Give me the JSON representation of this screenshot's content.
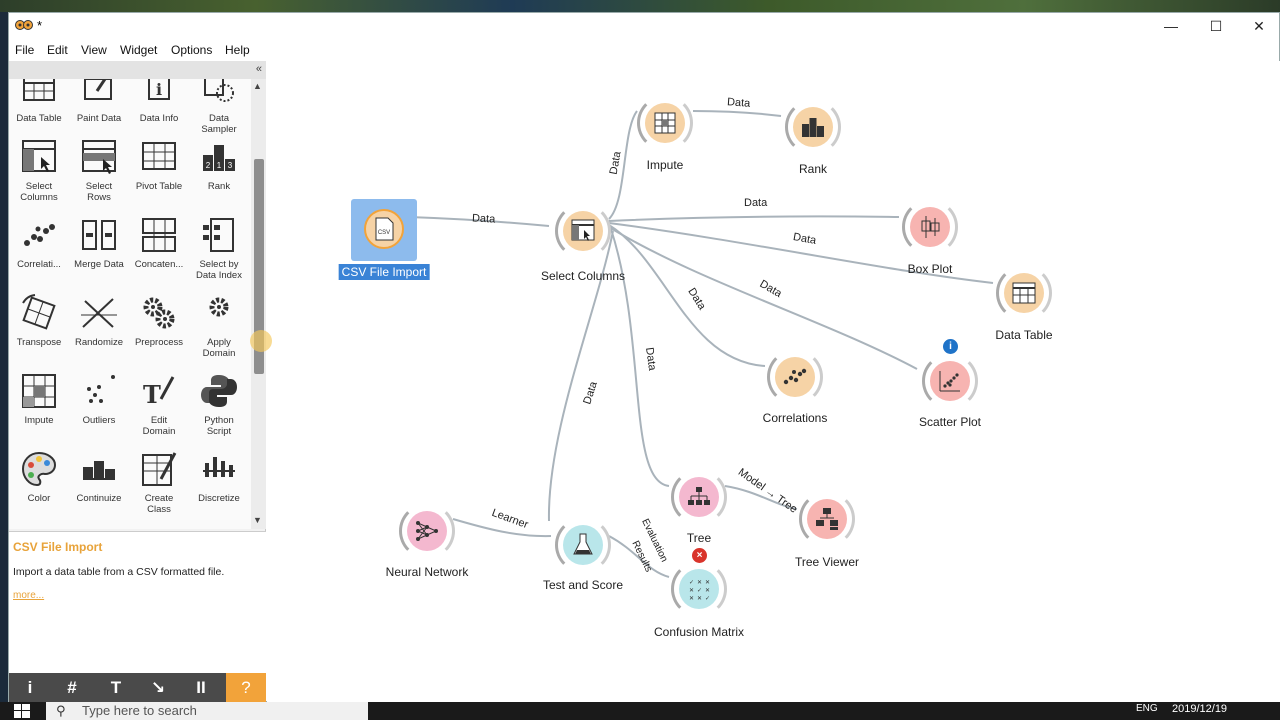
{
  "window": {
    "title": "*"
  },
  "menu": [
    "File",
    "Edit",
    "View",
    "Widget",
    "Options",
    "Help"
  ],
  "widgets": [
    {
      "label": "Data Table",
      "icon": "data-table-icon"
    },
    {
      "label": "Paint Data",
      "icon": "paint-data-icon"
    },
    {
      "label": "Data Info",
      "icon": "data-info-icon"
    },
    {
      "label": "Data\nSampler",
      "icon": "data-sampler-icon"
    },
    {
      "label": "Select\nColumns",
      "icon": "select-columns-icon"
    },
    {
      "label": "Select\nRows",
      "icon": "select-rows-icon"
    },
    {
      "label": "Pivot Table",
      "icon": "pivot-table-icon"
    },
    {
      "label": "Rank",
      "icon": "rank-icon"
    },
    {
      "label": "Correlati...",
      "icon": "correlations-icon"
    },
    {
      "label": "Merge Data",
      "icon": "merge-data-icon"
    },
    {
      "label": "Concaten...",
      "icon": "concatenate-icon"
    },
    {
      "label": "Select by\nData Index",
      "icon": "select-by-index-icon"
    },
    {
      "label": "Transpose",
      "icon": "transpose-icon"
    },
    {
      "label": "Randomize",
      "icon": "randomize-icon"
    },
    {
      "label": "Preprocess",
      "icon": "preprocess-icon"
    },
    {
      "label": "Apply\nDomain",
      "icon": "apply-domain-icon"
    },
    {
      "label": "Impute",
      "icon": "impute-icon"
    },
    {
      "label": "Outliers",
      "icon": "outliers-icon"
    },
    {
      "label": "Edit\nDomain",
      "icon": "edit-domain-icon"
    },
    {
      "label": "Python\nScript",
      "icon": "python-script-icon"
    },
    {
      "label": "Color",
      "icon": "color-icon"
    },
    {
      "label": "Continuize",
      "icon": "continuize-icon"
    },
    {
      "label": "Create\nClass",
      "icon": "create-class-icon"
    },
    {
      "label": "Discretize",
      "icon": "discretize-icon"
    }
  ],
  "help": {
    "title": "CSV File Import",
    "description": "Import a data table from a CSV formatted file.",
    "more": "more..."
  },
  "toolbar": {
    "info": "i",
    "grid": "#",
    "text": "T",
    "arrow": "↘",
    "pause": "II",
    "help": "?"
  },
  "nodes": {
    "csv": "CSV File Import",
    "select_columns": "Select Columns",
    "impute": "Impute",
    "rank": "Rank",
    "box_plot": "Box Plot",
    "data_table": "Data Table",
    "correlations": "Correlations",
    "scatter_plot": "Scatter Plot",
    "tree": "Tree",
    "tree_viewer": "Tree Viewer",
    "neural_network": "Neural Network",
    "test_and_score": "Test and Score",
    "confusion_matrix": "Confusion Matrix"
  },
  "links": {
    "data": "Data",
    "learner": "Learner",
    "model_tree": "Model → Tree",
    "eval_1": "Evaluation",
    "eval_2": "Results"
  },
  "badges": {
    "info": "i",
    "error": "×"
  },
  "taskbar": {
    "search_placeholder": "Type here to search",
    "date": "2019/12/19",
    "lang": "ENG"
  },
  "colors": {
    "data_node": "#f6d3a6",
    "vis_node": "#f7b4b1",
    "model_node": "#f4b8cf",
    "eval_node": "#b9e6ea",
    "accent": "#e8a33a",
    "selection": "#3a83d6"
  }
}
